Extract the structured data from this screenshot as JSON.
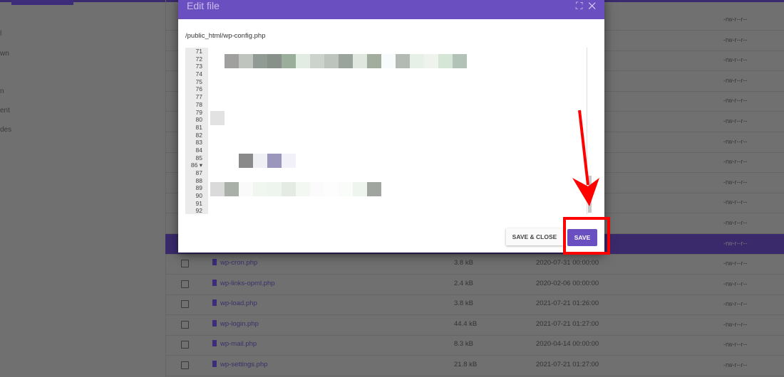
{
  "sidebar": {
    "items": [
      "l",
      "wn",
      "n",
      "ent",
      "des"
    ]
  },
  "background_rows": {
    "count_above": 12,
    "perm": "-rw-r--r--"
  },
  "files": [
    {
      "name": "wp-cron.php",
      "size": "3.8 kB",
      "date": "2020-07-31 00:00:00",
      "perm": "-rw-r--r--"
    },
    {
      "name": "wp-links-opml.php",
      "size": "2.4 kB",
      "date": "2020-02-06 00:00:00",
      "perm": "-rw-r--r--"
    },
    {
      "name": "wp-load.php",
      "size": "3.8 kB",
      "date": "2021-07-21 01:26:00",
      "perm": "-rw-r--r--"
    },
    {
      "name": "wp-login.php",
      "size": "44.4 kB",
      "date": "2021-07-21 01:27:00",
      "perm": "-rw-r--r--"
    },
    {
      "name": "wp-mail.php",
      "size": "8.3 kB",
      "date": "2020-04-14 00:00:00",
      "perm": "-rw-r--r--"
    },
    {
      "name": "wp-settings.php",
      "size": "21.8 kB",
      "date": "2021-07-21 01:27:00",
      "perm": "-rw-r--r--"
    }
  ],
  "dialog": {
    "title": "Edit file",
    "path": "/public_html/wp-config.php",
    "line_numbers": [
      "71",
      "72",
      "73",
      "74",
      "75",
      "76",
      "77",
      "78",
      "79",
      "80",
      "81",
      "82",
      "83",
      "84",
      "85",
      "86 ▾",
      "87",
      "88",
      "89",
      "90",
      "91",
      "92"
    ],
    "save_close_label": "SAVE & CLOSE",
    "save_label": "SAVE",
    "icons": {
      "expand": "expand-icon",
      "close": "close-icon"
    }
  },
  "colors": {
    "accent": "#6a4fc0",
    "highlight": "#ff0000"
  }
}
